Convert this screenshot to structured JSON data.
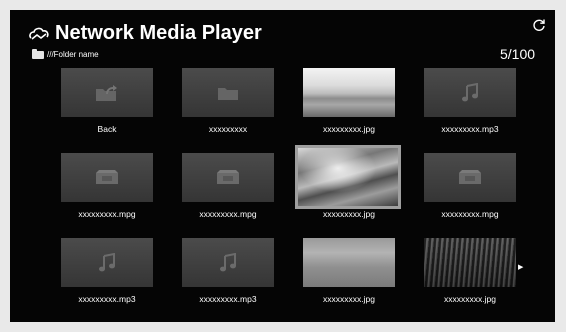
{
  "header": {
    "title": "Network Media Player",
    "folder_path": "///Folder name",
    "page_counter": "5/100"
  },
  "items": [
    {
      "label": "Back",
      "type": "back-folder"
    },
    {
      "label": "xxxxxxxxx",
      "type": "folder"
    },
    {
      "label": "xxxxxxxxx.jpg",
      "type": "photo-sky"
    },
    {
      "label": "xxxxxxxxx.mp3",
      "type": "music"
    },
    {
      "label": "xxxxxxxxx.mpg",
      "type": "video"
    },
    {
      "label": "xxxxxxxxx.mpg",
      "type": "video"
    },
    {
      "label": "xxxxxxxxx.jpg",
      "type": "photo-cloud",
      "selected": true
    },
    {
      "label": "xxxxxxxxx.mpg",
      "type": "video"
    },
    {
      "label": "xxxxxxxxx.mp3",
      "type": "music"
    },
    {
      "label": "xxxxxxxxx.mp3",
      "type": "music"
    },
    {
      "label": "xxxxxxxxx.jpg",
      "type": "photo-sea"
    },
    {
      "label": "xxxxxxxxx.jpg",
      "type": "photo-forest"
    }
  ],
  "colors": {
    "background": "#050505",
    "tile": "#454545",
    "selection_border": "#9f9f9f",
    "text": "#ffffff"
  }
}
